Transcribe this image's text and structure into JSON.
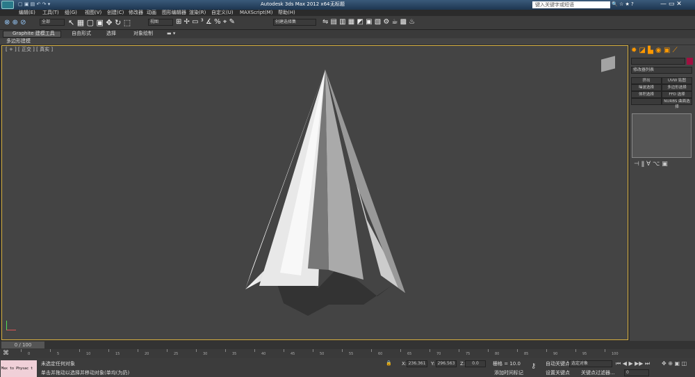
{
  "title": "Autodesk 3ds Max  2012 x64",
  "doc": "无标题",
  "search": "键入关键字或短语",
  "menus": [
    "编辑(E)",
    "工具(T)",
    "组(G)",
    "视图(V)",
    "创建(C)",
    "修改器",
    "动画",
    "图形编辑器",
    "渲染(R)",
    "自定义(U)",
    "MAXScript(M)",
    "帮助(H)"
  ],
  "toolbar": {
    "filter": "全部",
    "refsys": "视图",
    "selset": "创建选择集"
  },
  "ribbon": {
    "tabs": [
      "Graphite 建模工具",
      "自由形式",
      "选择",
      "对象绘制"
    ],
    "sub": "多边形建模"
  },
  "viewport": {
    "label": "[ + ] [ 正交 ] [ 真实 ]"
  },
  "cmd": {
    "modlist": "修改器列表",
    "buttons": [
      "挤出",
      "UVW 贴图",
      "噪波选择",
      "多边形选择",
      "体积选择",
      "FFD 选择",
      "",
      "NURBS 曲面选择"
    ]
  },
  "timeline": {
    "frame": "0 / 100",
    "ticks": [
      "0",
      "5",
      "10",
      "15",
      "20",
      "25",
      "30",
      "35",
      "40",
      "45",
      "50",
      "55",
      "60",
      "65",
      "70",
      "75",
      "80",
      "85",
      "90",
      "95",
      "100"
    ]
  },
  "status": {
    "script": "Max to Physac t",
    "line1": "未选定任何对象",
    "line2": "单击并拖动以选择并移动对象(单均(为扔)",
    "x": "236.361",
    "y": "296.563",
    "z": "0.0",
    "grid": "栅格 = 10.0",
    "autokey": "自动关键点",
    "selobj": "选定对象",
    "setkey": "设置关键点",
    "keyfilter": "关键点过滤器...",
    "addmark": "添加时间标记",
    "frame": "0"
  }
}
